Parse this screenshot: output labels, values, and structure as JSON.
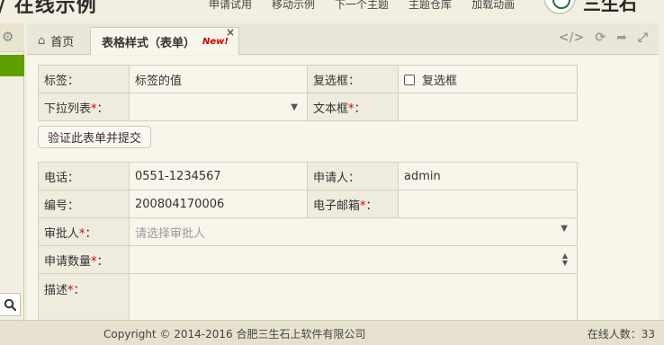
{
  "brand": {
    "title": "/ 在线示例"
  },
  "topnav": [
    "申请试用",
    "移动示例",
    "下一个主题",
    "主题仓库",
    "加载动画"
  ],
  "logo_text": "三生石",
  "tabs": {
    "home": "首页",
    "active": "表格样式（表单）",
    "active_badge": "New!"
  },
  "form1": {
    "label_label": "标签：",
    "label_value": "标签的值",
    "checkbox_label": "复选框：",
    "checkbox_text": "复选框",
    "dropdown_label": "下拉列表",
    "textbox_label": "文本框",
    "required_mark": "*",
    "colon": "："
  },
  "submit_button": "验证此表单并提交",
  "form2": {
    "phone_label": "电话：",
    "phone_value": "0551-1234567",
    "applicant_label": "申请人：",
    "applicant_value": "admin",
    "number_label": "编号：",
    "number_value": "200804170006",
    "email_label": "电子邮箱",
    "approver_label": "审批人",
    "approver_placeholder": "请选择审批人",
    "quantity_label": "申请数量",
    "description_label": "描述"
  },
  "footer": {
    "copyright": "Copyright © 2014-2016 合肥三生石上软件有限公司",
    "online": "在线人数：33"
  },
  "colors": {
    "accent_green": "#5fa000",
    "required_red": "#e00000",
    "background": "#f3efe0"
  }
}
